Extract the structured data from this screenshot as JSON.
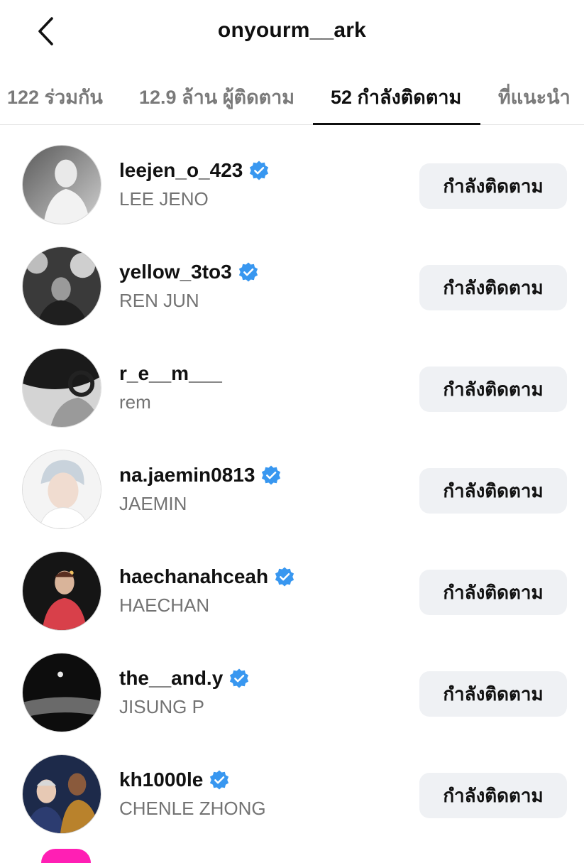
{
  "header": {
    "title": "onyourm__ark",
    "back_icon": "chevron-left-icon"
  },
  "tabs": [
    {
      "label": "122 ร่วมกัน",
      "active": false
    },
    {
      "label": "12.9 ล้าน ผู้ติดตาม",
      "active": false
    },
    {
      "label": "52 กำลังติดตาม",
      "active": true
    },
    {
      "label": "ที่แนะนำ",
      "active": false
    }
  ],
  "colors": {
    "verified_badge": "#3897f0",
    "button_bg": "#eff1f4",
    "muted_text": "#737373"
  },
  "following": [
    {
      "username": "leejen_o_423",
      "full_name": "LEE JENO",
      "verified": true,
      "button": "กำลังติดตาม"
    },
    {
      "username": "yellow_3to3",
      "full_name": "REN JUN",
      "verified": true,
      "button": "กำลังติดตาม"
    },
    {
      "username": "r_e__m___",
      "full_name": "rem",
      "verified": false,
      "button": "กำลังติดตาม"
    },
    {
      "username": "na.jaemin0813",
      "full_name": "JAEMIN",
      "verified": true,
      "button": "กำลังติดตาม"
    },
    {
      "username": "haechanahceah",
      "full_name": "HAECHAN",
      "verified": true,
      "button": "กำลังติดตาม"
    },
    {
      "username": "the__and.y",
      "full_name": "JISUNG P",
      "verified": true,
      "button": "กำลังติดตาม"
    },
    {
      "username": "kh1000le",
      "full_name": "CHENLE ZHONG",
      "verified": true,
      "button": "กำลังติดตาม"
    }
  ]
}
